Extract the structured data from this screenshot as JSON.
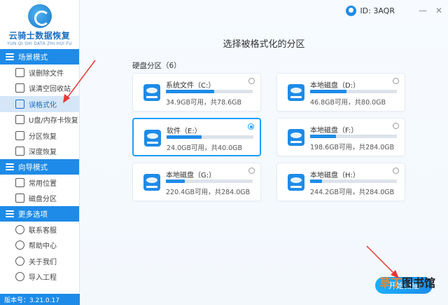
{
  "app": {
    "name": "云骑士数据恢复",
    "subtitle": "YUN QI SHI DATA ZHI HUI FU",
    "user_id": "ID: 3AQR",
    "version": "版本号：3.21.0.17"
  },
  "sidebar": {
    "sections": [
      {
        "title": "场景模式",
        "items": [
          "误删除文件",
          "误清空回收站",
          "误格式化",
          "U盘/内存卡恢复",
          "分区恢复",
          "深度恢复"
        ]
      },
      {
        "title": "向导模式",
        "items": [
          "常用位置",
          "磁盘分区"
        ]
      },
      {
        "title": "更多选项",
        "items": [
          "联系客服",
          "帮助中心",
          "关于我们",
          "导入工程"
        ]
      }
    ],
    "active_item": "误格式化"
  },
  "main": {
    "title": "选择被格式化的分区",
    "disk_count_label": "硬盘分区（6）",
    "start_button": "开始扫描",
    "watermark": "草丁图书馆",
    "watermark_accent": "草丁"
  },
  "partitions": [
    {
      "name": "系统文件（C:）",
      "info": "34.9GB可用，共78.6GB",
      "used_fraction": 0.56,
      "selected": false
    },
    {
      "name": "本地磁盘（D:）",
      "info": "46.8GB可用，共80.0GB",
      "used_fraction": 0.42,
      "selected": false
    },
    {
      "name": "软件（E:）",
      "info": "24.0GB可用，共40.0GB",
      "used_fraction": 0.4,
      "selected": true
    },
    {
      "name": "本地磁盘（F:）",
      "info": "198.6GB可用，共284.0GB",
      "used_fraction": 0.3,
      "selected": false
    },
    {
      "name": "本地磁盘（G:）",
      "info": "220.4GB可用，共284.0GB",
      "used_fraction": 0.22,
      "selected": false
    },
    {
      "name": "本地磁盘（H:）",
      "info": "244.2GB可用，共284.0GB",
      "used_fraction": 0.14,
      "selected": false
    }
  ],
  "colors": {
    "accent": "#1e8be8",
    "selected_border": "#1aa0ff",
    "annotation_arrow": "#e53935"
  },
  "icons": [
    "logo-icon",
    "user-icon",
    "minimize-icon",
    "close-icon",
    "disk-icon",
    "radio-icon"
  ]
}
